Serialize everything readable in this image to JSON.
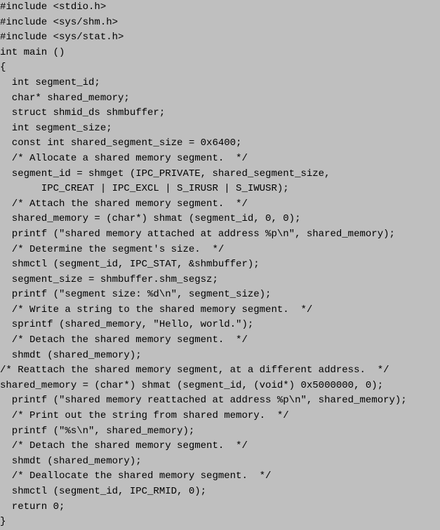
{
  "code": "#include <stdio.h>\n#include <sys/shm.h>\n#include <sys/stat.h>\nint main ()\n{\n  int segment_id;\n  char* shared_memory;\n  struct shmid_ds shmbuffer;\n  int segment_size;\n  const int shared_segment_size = 0x6400;\n  /* Allocate a shared memory segment.  */\n  segment_id = shmget (IPC_PRIVATE, shared_segment_size,\n       IPC_CREAT | IPC_EXCL | S_IRUSR | S_IWUSR);\n  /* Attach the shared memory segment.  */\n  shared_memory = (char*) shmat (segment_id, 0, 0);\n  printf (\"shared memory attached at address %p\\n\", shared_memory);\n  /* Determine the segment's size.  */\n  shmctl (segment_id, IPC_STAT, &shmbuffer);\n  segment_size = shmbuffer.shm_segsz;\n  printf (\"segment size: %d\\n\", segment_size);\n  /* Write a string to the shared memory segment.  */\n  sprintf (shared_memory, \"Hello, world.\");\n  /* Detach the shared memory segment.  */\n  shmdt (shared_memory);\n/* Reattach the shared memory segment, at a different address.  */\nshared_memory = (char*) shmat (segment_id, (void*) 0x5000000, 0);\n  printf (\"shared memory reattached at address %p\\n\", shared_memory);\n  /* Print out the string from shared memory.  */\n  printf (\"%s\\n\", shared_memory);\n  /* Detach the shared memory segment.  */\n  shmdt (shared_memory);\n  /* Deallocate the shared memory segment.  */\n  shmctl (segment_id, IPC_RMID, 0);\n  return 0;\n}"
}
